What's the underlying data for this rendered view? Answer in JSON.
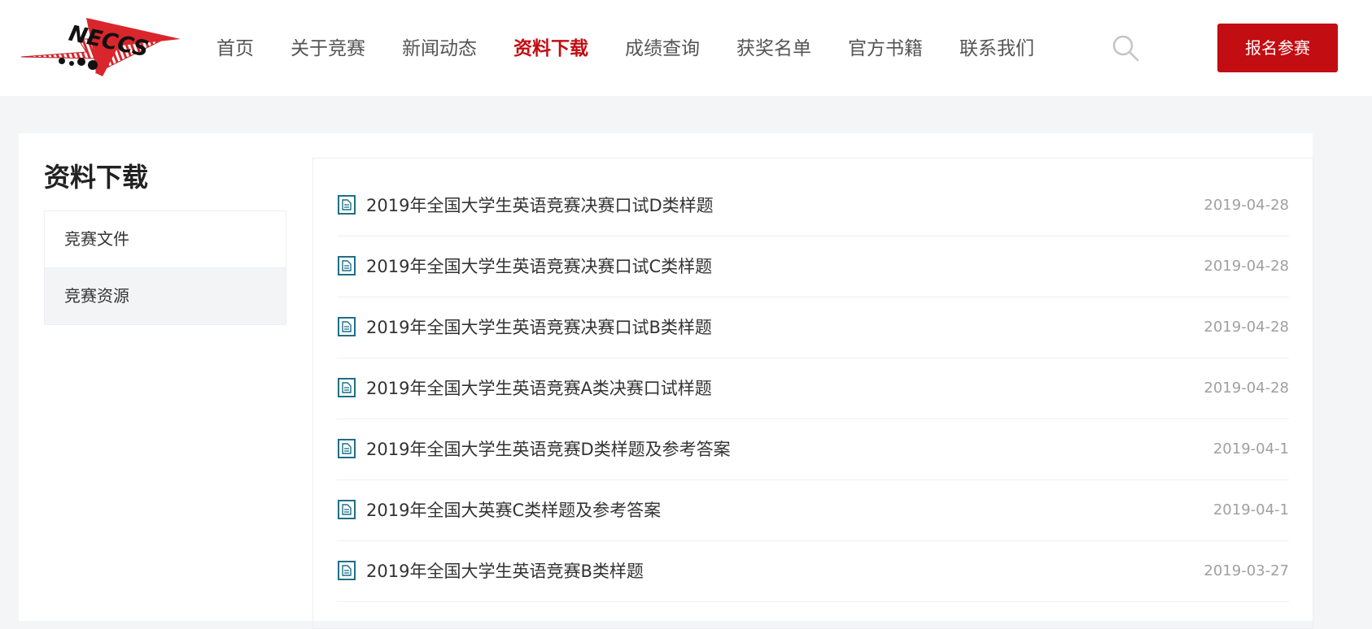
{
  "header": {
    "logo_text": "NECCS",
    "nav": [
      {
        "label": "首页",
        "active": false
      },
      {
        "label": "关于竞赛",
        "active": false
      },
      {
        "label": "新闻动态",
        "active": false
      },
      {
        "label": "资料下载",
        "active": true
      },
      {
        "label": "成绩查询",
        "active": false
      },
      {
        "label": "获奖名单",
        "active": false
      },
      {
        "label": "官方书籍",
        "active": false
      },
      {
        "label": "联系我们",
        "active": false
      }
    ],
    "search_icon": "search-icon",
    "register_label": "报名参赛"
  },
  "sidebar": {
    "title": "资料下载",
    "items": [
      {
        "label": "竞赛文件",
        "active": false
      },
      {
        "label": "竞赛资源",
        "active": true
      }
    ]
  },
  "documents": [
    {
      "title": "2019年全国大学生英语竞赛决赛口试D类样题",
      "date": "2019-04-28"
    },
    {
      "title": "2019年全国大学生英语竞赛决赛口试C类样题",
      "date": "2019-04-28"
    },
    {
      "title": "2019年全国大学生英语竞赛决赛口试B类样题",
      "date": "2019-04-28"
    },
    {
      "title": "2019年全国大学生英语竞赛A类决赛口试样题",
      "date": "2019-04-28"
    },
    {
      "title": "2019年全国大学生英语竞赛D类样题及参考答案",
      "date": "2019-04-1"
    },
    {
      "title": "2019年全国大英赛C类样题及参考答案",
      "date": "2019-04-1"
    },
    {
      "title": "2019年全国大学生英语竞赛B类样题",
      "date": "2019-03-27"
    }
  ],
  "colors": {
    "accent": "#c20d12",
    "doc_icon": "#1f6f86",
    "page_bg": "#f4f5f7"
  }
}
